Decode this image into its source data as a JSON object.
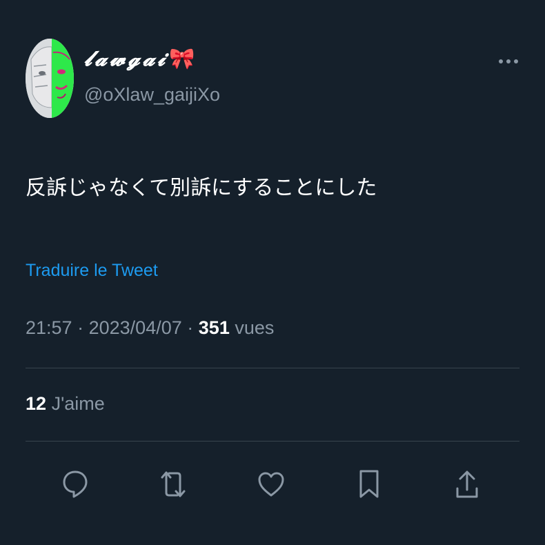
{
  "header": {
    "display_name": "𝓵𝓪𝔀𝓰𝓪𝓲",
    "display_name_emoji": "🎀",
    "handle": "@oXlaw_gaijiXo",
    "more_icon": "more-horizontal-icon"
  },
  "tweet": {
    "text": "反訴じゃなくて別訴にすることにした",
    "translate_label": "Traduire le Tweet",
    "time": "21:57",
    "date": "2023/04/07",
    "separator": "·",
    "views_count": "351",
    "views_label": "vues",
    "likes_count": "12",
    "likes_label": "J'aime"
  },
  "actions": [
    {
      "name": "reply",
      "icon": "reply-bubble-icon"
    },
    {
      "name": "retweet",
      "icon": "retweet-icon"
    },
    {
      "name": "like",
      "icon": "heart-icon"
    },
    {
      "name": "bookmark",
      "icon": "bookmark-icon"
    },
    {
      "name": "share",
      "icon": "share-icon"
    }
  ],
  "colors": {
    "background": "#15202b",
    "text": "#ffffff",
    "secondary_text": "#8b98a5",
    "link": "#1d9bf0",
    "divider": "#38444d",
    "avatar_accent": "#2ee84a"
  }
}
